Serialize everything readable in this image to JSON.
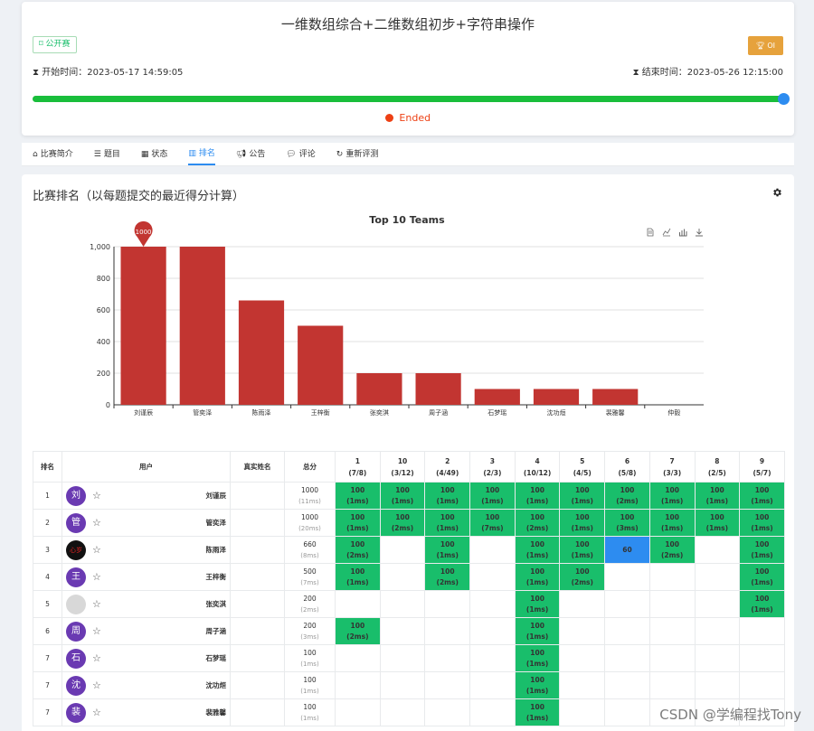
{
  "contest": {
    "title": "一维数组综合+二维数组初步+字符串操作",
    "type_tag": "公开赛",
    "rule_tag": "OI",
    "start_label": "开始时间：2023-05-17 14:59:05",
    "end_label": "结束时间：2023-05-26 12:15:00",
    "progress": 1.0,
    "status": "Ended"
  },
  "tabs": [
    {
      "label": "比赛简介",
      "icon": "home-icon"
    },
    {
      "label": "题目",
      "icon": "list-icon"
    },
    {
      "label": "状态",
      "icon": "grid-icon"
    },
    {
      "label": "排名",
      "icon": "bar-chart-icon",
      "active": true
    },
    {
      "label": "公告",
      "icon": "megaphone-icon"
    },
    {
      "label": "评论",
      "icon": "comment-icon"
    },
    {
      "label": "重新评测",
      "icon": "refresh-icon"
    }
  ],
  "ranking": {
    "heading": "比赛排名（以每题提交的最近得分计算）"
  },
  "chart_data": {
    "type": "bar",
    "title": "Top 10 Teams",
    "categories": [
      "刘谨辰",
      "管奕泽",
      "陈雨泽",
      "王梓衡",
      "张奕淇",
      "周子涵",
      "石梦瑶",
      "沈功烜",
      "裴雅馨",
      "仲毅"
    ],
    "values": [
      1000,
      1000,
      660,
      500,
      200,
      200,
      100,
      100,
      100,
      0
    ],
    "ylim": [
      0,
      1000
    ],
    "yticks": [
      0,
      200,
      400,
      600,
      800,
      1000
    ],
    "ytick_labels": [
      "0",
      "200",
      "400",
      "600",
      "800",
      "1,000"
    ],
    "max_marker": "1000",
    "bar_color": "#c23531",
    "grid": true
  },
  "table": {
    "headers": {
      "rank": "排名",
      "user": "用户",
      "realname": "真实姓名",
      "total": "总分"
    },
    "problems": [
      {
        "id": "1",
        "stat": "(7/8)"
      },
      {
        "id": "10",
        "stat": "(3/12)"
      },
      {
        "id": "2",
        "stat": "(4/49)"
      },
      {
        "id": "3",
        "stat": "(2/3)"
      },
      {
        "id": "4",
        "stat": "(10/12)"
      },
      {
        "id": "5",
        "stat": "(4/5)"
      },
      {
        "id": "6",
        "stat": "(5/8)"
      },
      {
        "id": "7",
        "stat": "(3/3)"
      },
      {
        "id": "8",
        "stat": "(2/5)"
      },
      {
        "id": "9",
        "stat": "(5/7)"
      }
    ],
    "rows": [
      {
        "rank": "1",
        "avatar": "刘",
        "name": "刘谨辰",
        "total": "1000",
        "time": "(11ms)",
        "cells": [
          [
            "100",
            "(1ms)"
          ],
          [
            "100",
            "(1ms)"
          ],
          [
            "100",
            "(1ms)"
          ],
          [
            "100",
            "(1ms)"
          ],
          [
            "100",
            "(1ms)"
          ],
          [
            "100",
            "(1ms)"
          ],
          [
            "100",
            "(2ms)"
          ],
          [
            "100",
            "(1ms)"
          ],
          [
            "100",
            "(1ms)"
          ],
          [
            "100",
            "(1ms)"
          ]
        ]
      },
      {
        "rank": "2",
        "avatar": "管",
        "name": "管奕泽",
        "total": "1000",
        "time": "(20ms)",
        "cells": [
          [
            "100",
            "(1ms)"
          ],
          [
            "100",
            "(2ms)"
          ],
          [
            "100",
            "(1ms)"
          ],
          [
            "100",
            "(7ms)"
          ],
          [
            "100",
            "(2ms)"
          ],
          [
            "100",
            "(1ms)"
          ],
          [
            "100",
            "(3ms)"
          ],
          [
            "100",
            "(1ms)"
          ],
          [
            "100",
            "(1ms)"
          ],
          [
            "100",
            "(1ms)"
          ]
        ]
      },
      {
        "rank": "3",
        "avatar": "心岁",
        "name": "陈雨泽",
        "total": "660",
        "time": "(8ms)",
        "cells": [
          [
            "100",
            "(2ms)"
          ],
          null,
          [
            "100",
            "(1ms)"
          ],
          null,
          [
            "100",
            "(1ms)"
          ],
          [
            "100",
            "(1ms)"
          ],
          [
            "60",
            ""
          ],
          [
            "100",
            "(2ms)"
          ],
          null,
          [
            "100",
            "(1ms)"
          ]
        ]
      },
      {
        "rank": "4",
        "avatar": "王",
        "name": "王梓衡",
        "total": "500",
        "time": "(7ms)",
        "cells": [
          [
            "100",
            "(1ms)"
          ],
          null,
          [
            "100",
            "(2ms)"
          ],
          null,
          [
            "100",
            "(1ms)"
          ],
          [
            "100",
            "(2ms)"
          ],
          null,
          null,
          null,
          [
            "100",
            "(1ms)"
          ]
        ]
      },
      {
        "rank": "5",
        "avatar": "",
        "name": "张奕淇",
        "total": "200",
        "time": "(2ms)",
        "cells": [
          null,
          null,
          null,
          null,
          [
            "100",
            "(1ms)"
          ],
          null,
          null,
          null,
          null,
          [
            "100",
            "(1ms)"
          ]
        ]
      },
      {
        "rank": "6",
        "avatar": "周",
        "name": "周子涵",
        "total": "200",
        "time": "(3ms)",
        "cells": [
          [
            "100",
            "(2ms)"
          ],
          null,
          null,
          null,
          [
            "100",
            "(1ms)"
          ],
          null,
          null,
          null,
          null,
          null
        ]
      },
      {
        "rank": "7",
        "avatar": "石",
        "name": "石梦瑶",
        "total": "100",
        "time": "(1ms)",
        "cells": [
          null,
          null,
          null,
          null,
          [
            "100",
            "(1ms)"
          ],
          null,
          null,
          null,
          null,
          null
        ]
      },
      {
        "rank": "7",
        "avatar": "沈",
        "name": "沈功烜",
        "total": "100",
        "time": "(1ms)",
        "cells": [
          null,
          null,
          null,
          null,
          [
            "100",
            "(1ms)"
          ],
          null,
          null,
          null,
          null,
          null
        ]
      },
      {
        "rank": "7",
        "avatar": "裴",
        "name": "裴雅馨",
        "total": "100",
        "time": "(1ms)",
        "cells": [
          null,
          null,
          null,
          null,
          [
            "100",
            "(1ms)"
          ],
          null,
          null,
          null,
          null,
          null
        ]
      }
    ]
  },
  "watermark": "CSDN @学编程找Tony"
}
